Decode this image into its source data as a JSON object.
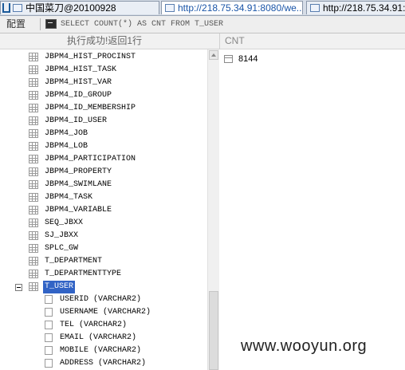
{
  "tabs": [
    {
      "label": "中国菜刀@20100928"
    },
    {
      "label": "http://218.75.34.91:8080/we..."
    },
    {
      "label": "http://218.75.34.91:8"
    }
  ],
  "toolbar": {
    "config_label": "配置",
    "sql": "SELECT COUNT(*) AS CNT FROM T_USER"
  },
  "status": "执行成功!返回1行",
  "result": {
    "column": "CNT",
    "value": "8144"
  },
  "tree": {
    "tables_before": [
      "JBPM4_HIST_PROCINST",
      "JBPM4_HIST_TASK",
      "JBPM4_HIST_VAR",
      "JBPM4_ID_GROUP",
      "JBPM4_ID_MEMBERSHIP",
      "JBPM4_ID_USER",
      "JBPM4_JOB",
      "JBPM4_LOB",
      "JBPM4_PARTICIPATION",
      "JBPM4_PROPERTY",
      "JBPM4_SWIMLANE",
      "JBPM4_TASK",
      "JBPM4_VARIABLE",
      "SEQ_JBXX",
      "SJ_JBXX",
      "SPLC_GW",
      "T_DEPARTMENT",
      "T_DEPARTMENTTYPE"
    ],
    "selected_table": "T_USER",
    "columns": [
      "USERID (VARCHAR2)",
      "USERNAME (VARCHAR2)",
      "TEL (VARCHAR2)",
      "EMAIL (VARCHAR2)",
      "MOBILE (VARCHAR2)",
      "ADDRESS (VARCHAR2)"
    ]
  },
  "watermark": "www.wooyun.org",
  "colors": {
    "selection": "#3163c5",
    "tab_link": "#1a55a8"
  }
}
